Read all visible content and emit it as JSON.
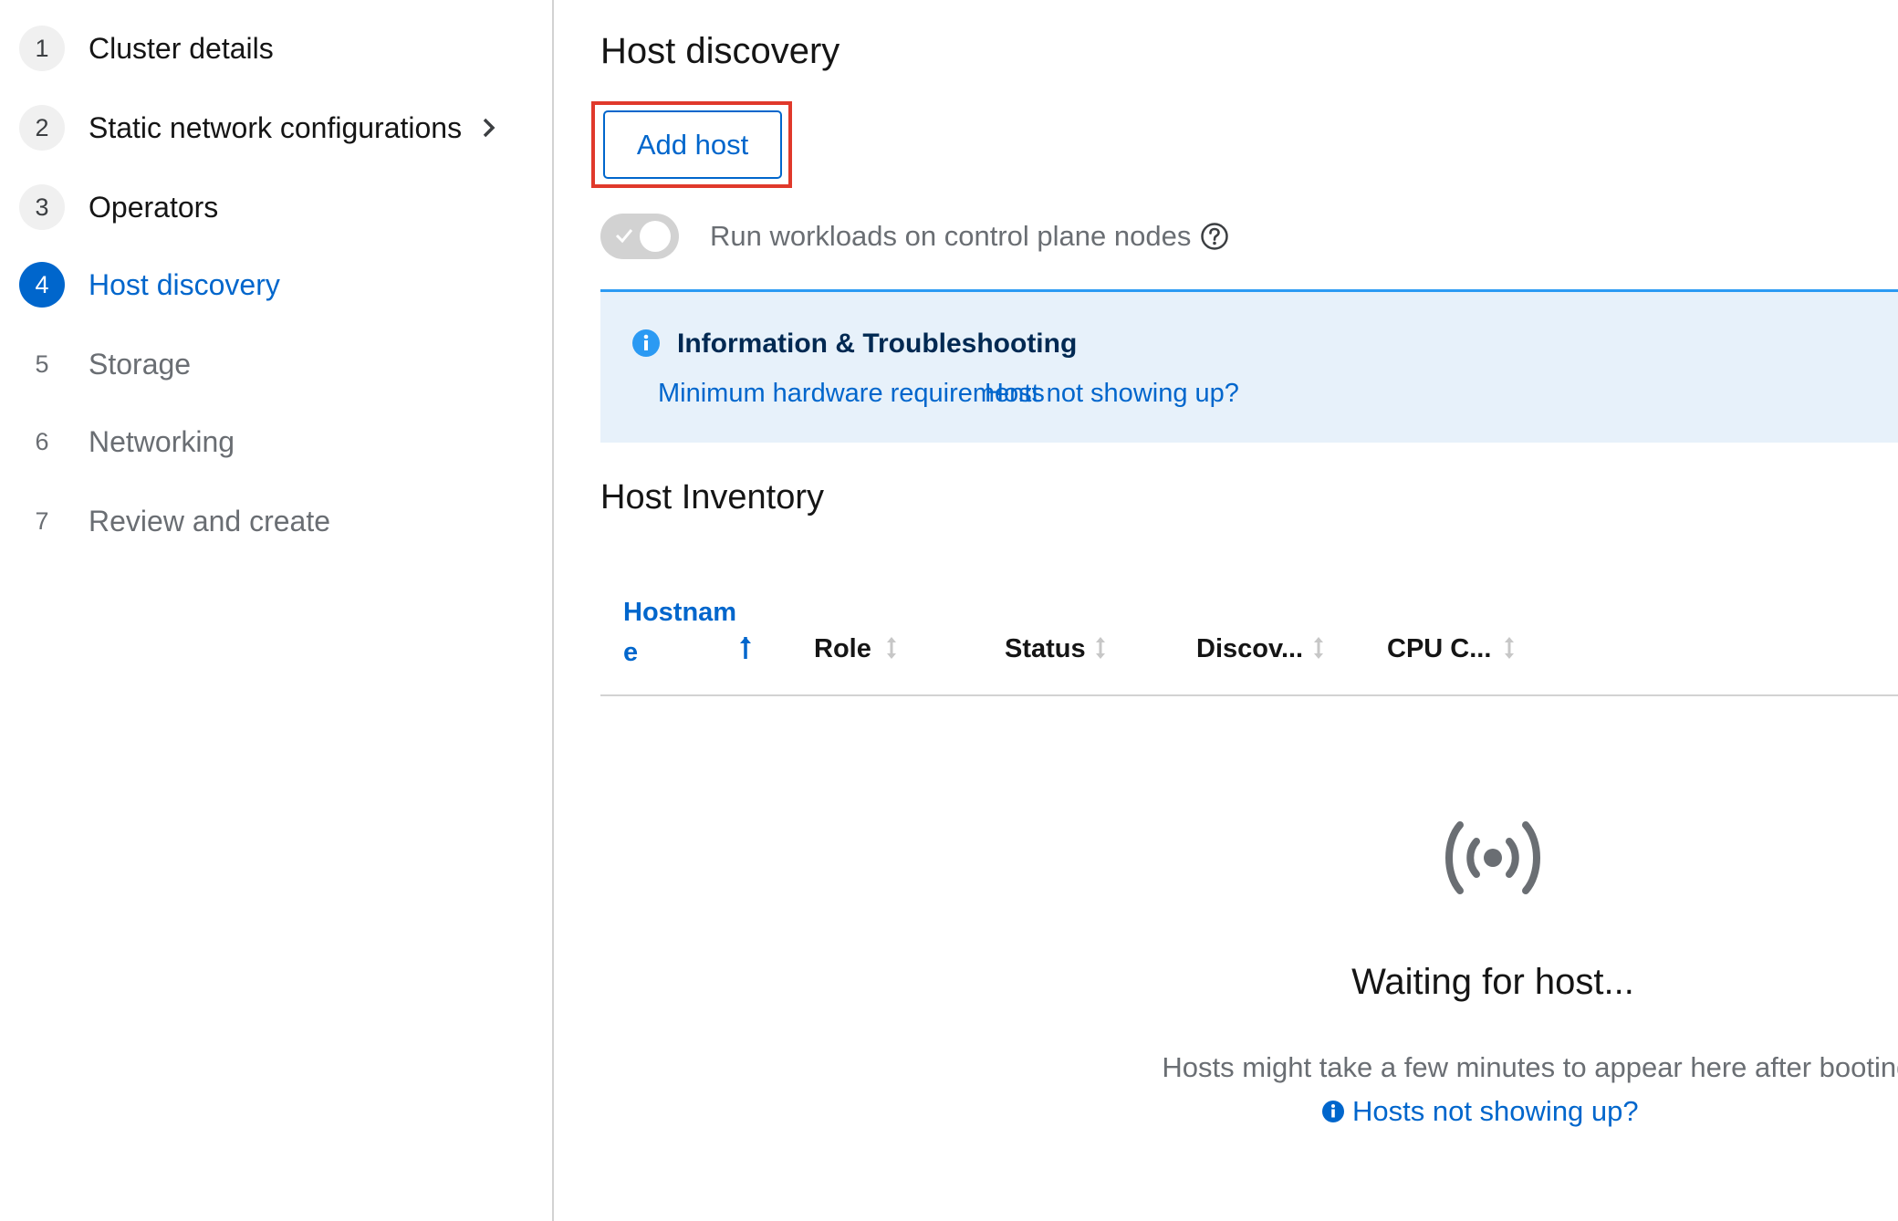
{
  "wizard": {
    "steps": [
      {
        "number": "1",
        "label": "Cluster details",
        "state": "done"
      },
      {
        "number": "2",
        "label": "Static network configurations",
        "state": "done",
        "has_submenu": true
      },
      {
        "number": "3",
        "label": "Operators",
        "state": "done"
      },
      {
        "number": "4",
        "label": "Host discovery",
        "state": "current"
      },
      {
        "number": "5",
        "label": "Storage",
        "state": "todo"
      },
      {
        "number": "6",
        "label": "Networking",
        "state": "todo"
      },
      {
        "number": "7",
        "label": "Review and create",
        "state": "todo"
      }
    ]
  },
  "main": {
    "title": "Host discovery",
    "add_host_label": "Add host",
    "switch_label": "Run workloads on control plane nodes",
    "alert": {
      "title": "Information & Troubleshooting",
      "link_1": "Minimum hardware requirements",
      "link_2": "Host not showing up?"
    },
    "inventory": {
      "title": "Host Inventory",
      "columns": [
        {
          "label_line_1": "Hostnam",
          "label_line_2": "e",
          "sorted": "ascending"
        },
        {
          "label": "Role"
        },
        {
          "label": "Status"
        },
        {
          "label": "Discov..."
        },
        {
          "label": "CPU C..."
        }
      ]
    },
    "empty_state": {
      "icon": "broadcast-icon",
      "title": "Waiting for host...",
      "body": "Hosts might take a few minutes to appear here after booting.",
      "link": "Hosts not showing up?"
    }
  },
  "colors": {
    "accent": "#0066cc",
    "highlight_box": "#e0392b",
    "alert_background": "#e7f1fa",
    "alert_border": "#2b9af3",
    "muted_text": "#6a6e73"
  }
}
